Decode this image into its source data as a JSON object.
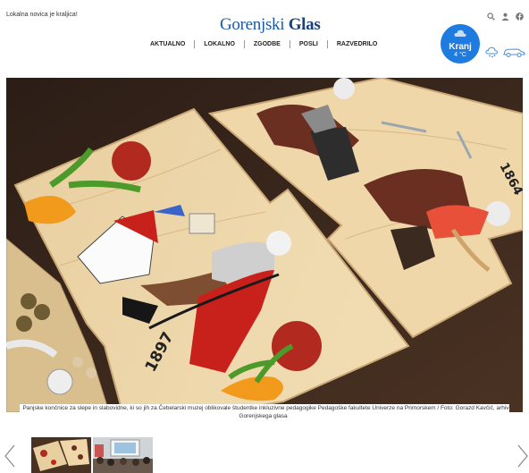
{
  "header": {
    "tagline": "Lokalna novica je kraljica!",
    "logo_part1": "Gorenjski",
    "logo_part2": "Glas",
    "icons": [
      "search-icon",
      "user-icon",
      "facebook-icon"
    ]
  },
  "nav": {
    "items": [
      {
        "label": "AKTUALNO"
      },
      {
        "label": "LOKALNO"
      },
      {
        "label": "ZGODBE"
      },
      {
        "label": "POSLI"
      },
      {
        "label": "RAZVEDRILO"
      }
    ]
  },
  "weather": {
    "city": "Kranj",
    "temp": "4 °C",
    "icons": [
      "snow-cloud-icon",
      "car-icon"
    ]
  },
  "gallery": {
    "caption": "Panjske končnice za slepe in slabovidne, ki so jih za Čebelarski muzej oblikovale študentke inkluzivne pedagogike Pedagoške fakultete Univerze na Primorskem / Foto: Gorazd Kavčič, arhiv Gorenjskega glasa",
    "year_left": "1897",
    "year_right": "1864",
    "thumbnails": 2
  },
  "colors": {
    "brand": "#1a5aa8",
    "weather_bg": "#1e7be0"
  }
}
